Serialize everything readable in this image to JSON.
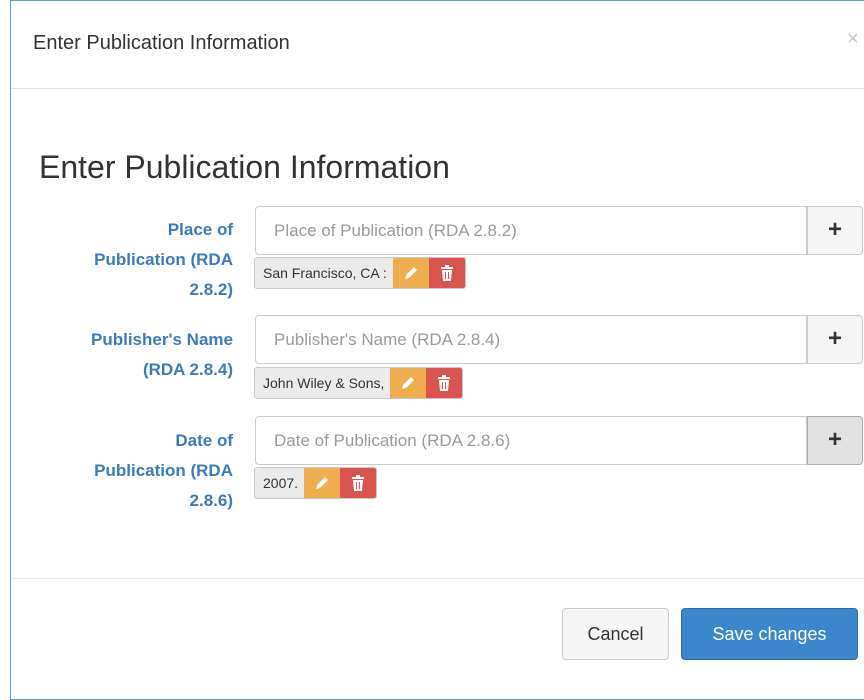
{
  "dialog": {
    "title": "Enter Publication Information",
    "close": "×"
  },
  "form": {
    "heading": "Enter Publication Information",
    "fields": [
      {
        "label_lines": [
          "Place of",
          "Publication (RDA",
          "2.8.2)"
        ],
        "placeholder": "Place of Publication (RDA 2.8.2)",
        "value": "",
        "add": "+",
        "tag": "San Francisco, CA :"
      },
      {
        "label_lines": [
          "Publisher's Name",
          "(RDA 2.8.4)"
        ],
        "placeholder": "Publisher's Name (RDA 2.8.4)",
        "value": "",
        "add": "+",
        "tag": "John Wiley & Sons,"
      },
      {
        "label_lines": [
          "Date of",
          "Publication (RDA",
          "2.8.6)"
        ],
        "placeholder": "Date of Publication (RDA 2.8.6)",
        "value": "",
        "add": "+",
        "tag": "2007."
      }
    ]
  },
  "footer": {
    "cancel": "Cancel",
    "save": "Save changes"
  },
  "colors": {
    "label": "#3a7bbf",
    "edit": "#f0ad4e",
    "delete": "#d9534f",
    "primary": "#3a87cd"
  },
  "icons": {
    "add": "plus-icon",
    "edit": "pencil-icon",
    "delete": "trash-icon",
    "close": "close-icon"
  }
}
